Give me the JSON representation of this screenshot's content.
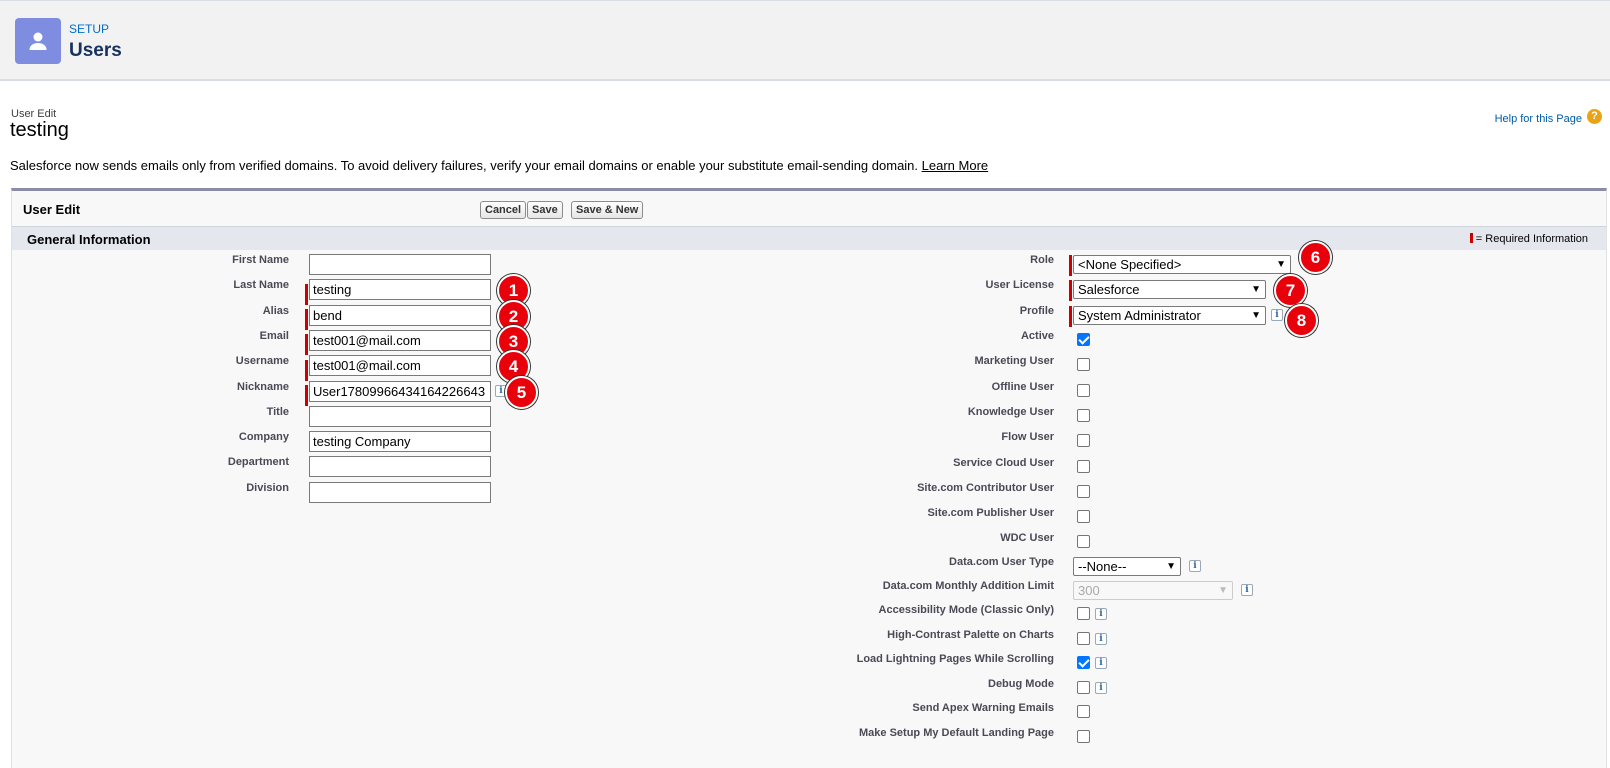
{
  "header": {
    "setup_label": "SETUP",
    "title": "Users",
    "icon": "user-icon"
  },
  "page": {
    "subtitle": "User Edit",
    "title": "testing",
    "help_link": "Help for this Page",
    "help_icon": "?",
    "notice_text": "Salesforce now sends emails only from verified domains. To avoid delivery failures, verify your email domains or enable your substitute email-sending domain.",
    "notice_link": "Learn More"
  },
  "panel": {
    "title": "User Edit",
    "buttons": {
      "cancel": "Cancel",
      "save": "Save",
      "save_new": "Save & New"
    },
    "section_title": "General Information",
    "required_info": "= Required Information"
  },
  "left_fields": [
    {
      "label": "First Name",
      "value": "",
      "required": false
    },
    {
      "label": "Last Name",
      "value": "testing",
      "required": true,
      "badge": "1"
    },
    {
      "label": "Alias",
      "value": "bend",
      "required": true,
      "badge": "2"
    },
    {
      "label": "Email",
      "value": "test001@mail.com",
      "required": true,
      "badge": "3"
    },
    {
      "label": "Username",
      "value": "test001@mail.com",
      "required": true,
      "badge": "4"
    },
    {
      "label": "Nickname",
      "value": "User17809966434164226643",
      "required": true,
      "badge": "5"
    },
    {
      "label": "Title",
      "value": "",
      "required": false
    },
    {
      "label": "Company",
      "value": "testing Company",
      "required": false
    },
    {
      "label": "Department",
      "value": "",
      "required": false
    },
    {
      "label": "Division",
      "value": "",
      "required": false
    }
  ],
  "right_selects": [
    {
      "label": "Role",
      "value": "<None Specified>",
      "badge": "6"
    },
    {
      "label": "User License",
      "value": "Salesforce",
      "badge": "7"
    },
    {
      "label": "Profile",
      "value": "System Administrator",
      "badge": "8"
    }
  ],
  "right_checks": [
    {
      "label": "Active",
      "checked": true
    },
    {
      "label": "Marketing User",
      "checked": false
    },
    {
      "label": "Offline User",
      "checked": false
    },
    {
      "label": "Knowledge User",
      "checked": false
    },
    {
      "label": "Flow User",
      "checked": false
    },
    {
      "label": "Service Cloud User",
      "checked": false
    },
    {
      "label": "Site.com Contributor User",
      "checked": false
    },
    {
      "label": "Site.com Publisher User",
      "checked": false
    },
    {
      "label": "WDC User",
      "checked": false
    }
  ],
  "datacom": {
    "user_type_label": "Data.com User Type",
    "user_type_value": "--None--",
    "monthly_limit_label": "Data.com Monthly Addition Limit",
    "monthly_limit_value": "300"
  },
  "pref_checks": [
    {
      "label": "Accessibility Mode (Classic Only)",
      "checked": false,
      "info": true
    },
    {
      "label": "High-Contrast Palette on Charts",
      "checked": false,
      "info": true
    },
    {
      "label": "Load Lightning Pages While Scrolling",
      "checked": true,
      "info": true
    },
    {
      "label": "Debug Mode",
      "checked": false,
      "info": true
    },
    {
      "label": "Send Apex Warning Emails",
      "checked": false,
      "info": false
    },
    {
      "label": "Make Setup My Default Landing Page",
      "checked": false,
      "info": false
    }
  ],
  "info_glyph": "i",
  "colors": {
    "required": "#cc0000",
    "badge": "#e8000b",
    "link": "#006dcc",
    "header_icon": "#7f8de1"
  }
}
